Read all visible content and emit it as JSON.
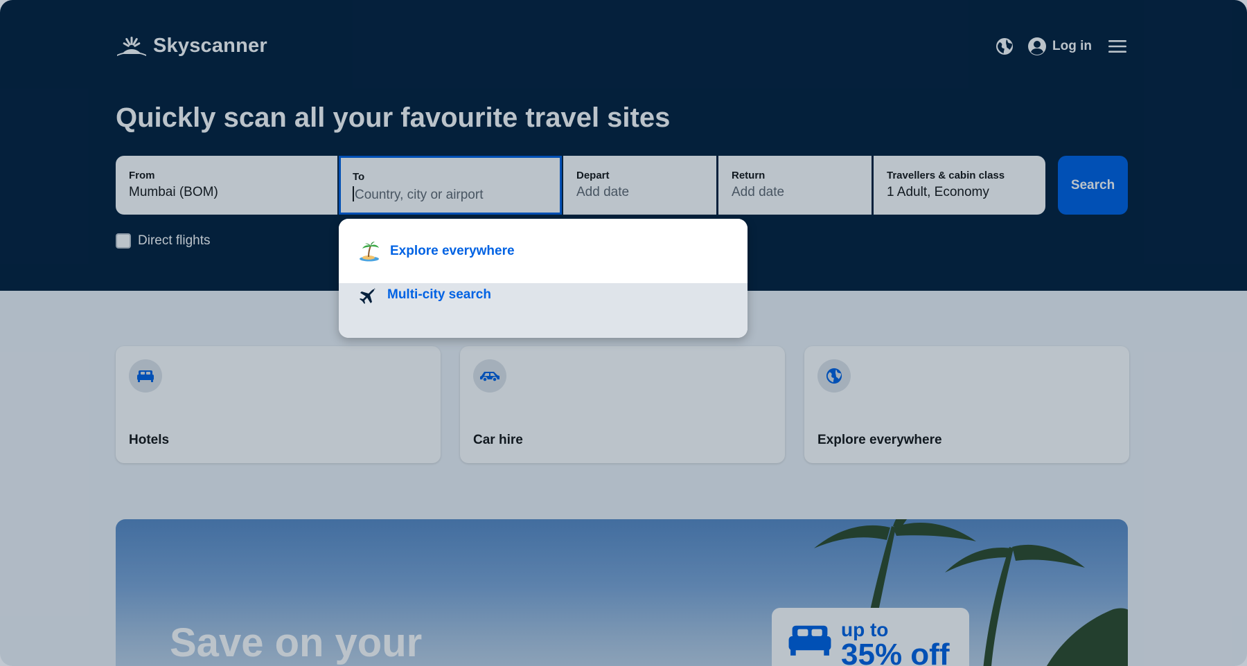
{
  "brand": {
    "name": "Skyscanner"
  },
  "header": {
    "login_label": "Log in",
    "icons": [
      "globe-icon",
      "account-icon",
      "menu-icon"
    ]
  },
  "hero": {
    "headline": "Quickly scan all your favourite travel sites"
  },
  "search": {
    "from": {
      "label": "From",
      "value": "Mumbai (BOM)"
    },
    "to": {
      "label": "To",
      "placeholder": "Country, city or airport",
      "value": ""
    },
    "depart": {
      "label": "Depart",
      "placeholder": "Add date"
    },
    "return": {
      "label": "Return",
      "placeholder": "Add date"
    },
    "travellers": {
      "label": "Travellers & cabin class",
      "value": "1 Adult, Economy"
    },
    "button_label": "Search",
    "direct_flights_label": "Direct flights",
    "direct_flights_checked": false
  },
  "dropdown": {
    "items": [
      {
        "label": "Explore everywhere",
        "icon": "island-icon"
      },
      {
        "label": "Multi-city search",
        "icon": "plane-icon"
      }
    ]
  },
  "cards": [
    {
      "title": "Hotels",
      "icon": "bed-icon"
    },
    {
      "title": "Car hire",
      "icon": "car-icon"
    },
    {
      "title": "Explore everywhere",
      "icon": "globe-icon"
    }
  ],
  "banner": {
    "text": "Save on your",
    "promo_upto": "up to",
    "promo_pct": "35% off"
  },
  "colors": {
    "navy": "#05203c",
    "accent": "#0062e3",
    "page": "#eff3f8"
  }
}
